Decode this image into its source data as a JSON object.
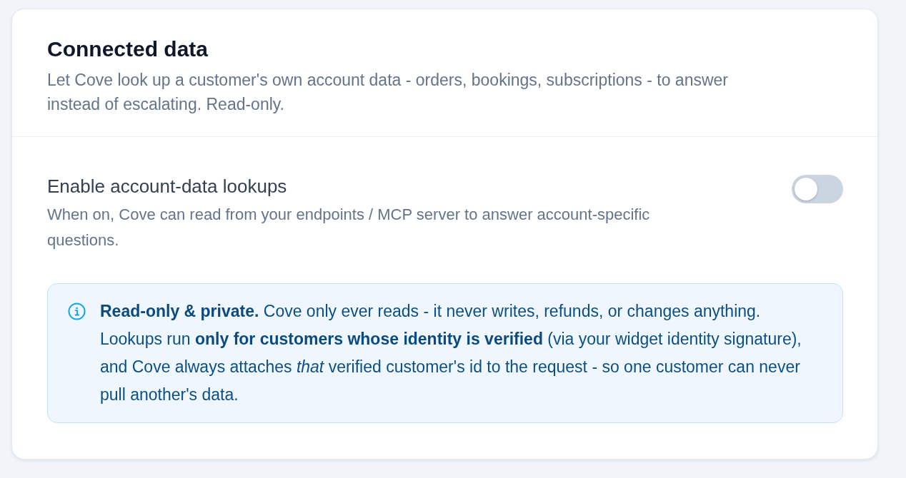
{
  "section": {
    "title": "Connected data",
    "description": "Let Cove look up a customer's own account data - orders, bookings, subscriptions - to answer instead of escalating. Read-only."
  },
  "setting": {
    "label": "Enable account-data lookups",
    "description": "When on, Cove can read from your endpoints / MCP server to answer account-specific questions.",
    "on": false
  },
  "notice": {
    "text": "**Read-only & private.** Cove only ever reads - it never writes, refunds, or changes anything. Lookups run **only for customers whose identity is verified** (via your widget identity signature), and Cove always attaches *that* verified customer's id to the request - so one customer can never pull another's data."
  }
}
